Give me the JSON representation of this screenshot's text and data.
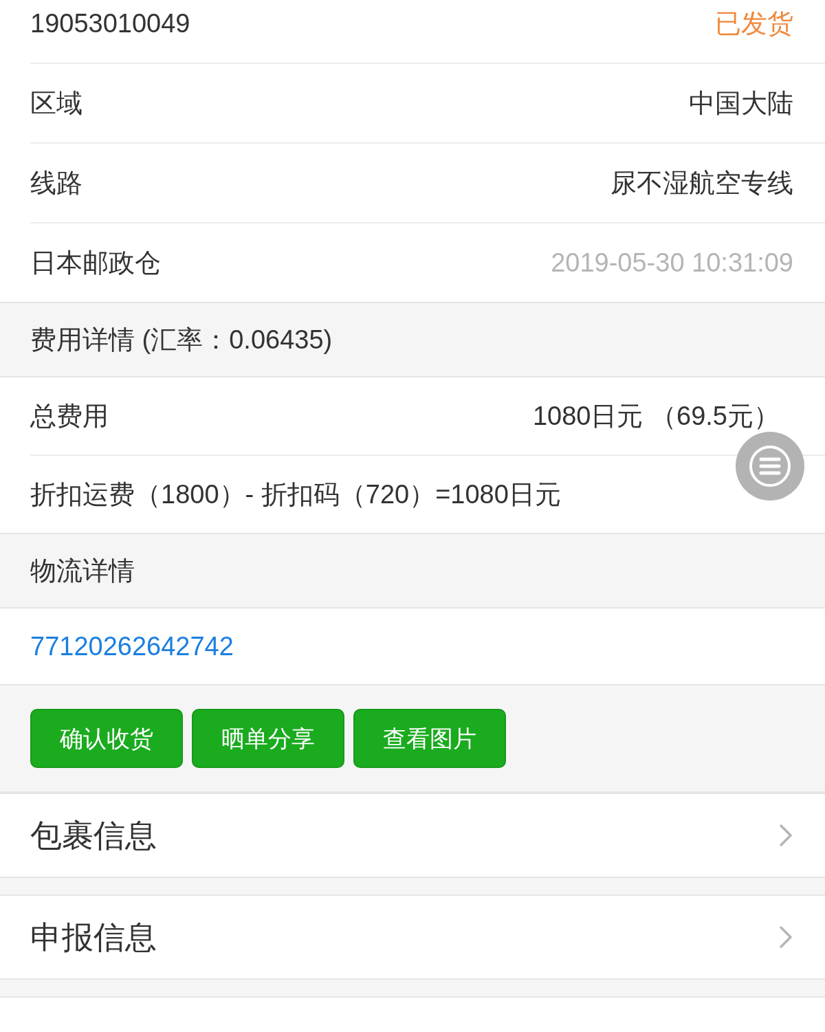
{
  "order": {
    "number": "19053010049",
    "status": "已发货"
  },
  "info_rows": [
    {
      "label": "区域",
      "value": "中国大陆",
      "kind": "plain"
    },
    {
      "label": "线路",
      "value": "尿不湿航空专线",
      "kind": "plain"
    },
    {
      "label": "日本邮政仓",
      "value": "2019-05-30 10:31:09",
      "kind": "muted"
    }
  ],
  "fee": {
    "header": "费用详情 (汇率：0.06435)",
    "total_label": "总费用",
    "total_value": "1080日元 （69.5元）",
    "formula": "折扣运费（1800）- 折扣码（720）=1080日元"
  },
  "logistics": {
    "header": "物流详情",
    "tracking": "77120262642742"
  },
  "buttons": [
    "确认收货",
    "晒单分享",
    "查看图片"
  ],
  "sections": [
    "包裹信息",
    "申报信息"
  ]
}
